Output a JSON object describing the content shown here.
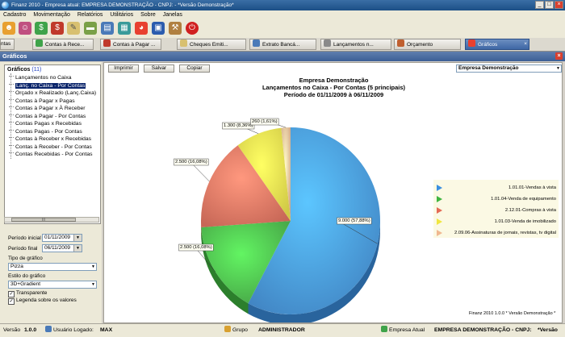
{
  "window": {
    "title": "Finanz 2010 - Empresa atual: EMPRESA DEMONSTRAÇÃO - CNPJ: - *Versão Demonstração*",
    "minimize": "_",
    "maximize": "□",
    "close": "×"
  },
  "menu": [
    "Cadastro",
    "Movimentação",
    "Relatórios",
    "Utilitários",
    "Sobre",
    "Janelas"
  ],
  "tabs": [
    {
      "label": "ntas",
      "icon_color": "#6aa0d8"
    },
    {
      "label": "Contas à Rece...",
      "icon_color": "#3fa34a"
    },
    {
      "label": "Contas à Pagar ...",
      "icon_color": "#c0392b"
    },
    {
      "label": "Cheques Emiti...",
      "icon_color": "#d8c070"
    },
    {
      "label": "Extrato Bancá...",
      "icon_color": "#4a7ab8"
    },
    {
      "label": "Lançamentos n...",
      "icon_color": "#8a8a8a"
    },
    {
      "label": "Orçamento",
      "icon_color": "#c06030"
    },
    {
      "label": "Gráficos",
      "icon_color": "#e84030",
      "active": true
    }
  ],
  "tab_close": "×",
  "panel": {
    "title": "Gráficos",
    "close": "×"
  },
  "tree": {
    "root_label": "Gráficos",
    "root_count": "(11)",
    "items": [
      "Lançamentos no Caixa",
      "Lanç. no Caixa - Por Contas",
      "Orçado x Realizado (Lanç.Caixa)",
      "Contas à Pagar x Pagas",
      "Contas à Pagar x À Receber",
      "Contas à Pagar - Por Contas",
      "Contas Pagas x Recebidas",
      "Contas Pagas - Por Contas",
      "Contas à Receber x Recebidas",
      "Contas à Receber - Por Contas",
      "Contas Recebidas - Por Contas"
    ],
    "selected_index": 1
  },
  "scroll_grip": "III",
  "filters": {
    "periodo_inicial_label": "Período inicial",
    "periodo_inicial": "01/11/2009",
    "periodo_final_label": "Período final",
    "periodo_final": "06/11/2009",
    "tipo_label": "Tipo de gráfico",
    "tipo": "Pizza",
    "estilo_label": "Estilo do gráfico",
    "estilo": "3D+Gradient",
    "transparente_label": "Transparente",
    "legenda_label": "Legenda sobre os valores",
    "check_mark": "✓",
    "dropdown_glyph": "▼"
  },
  "toolbar_buttons": {
    "imprimir": "Imprimir",
    "salvar": "Salvar",
    "copiar": "Copiar"
  },
  "empresa_select": "Empresa Demonstração",
  "chart_data": {
    "type": "pie",
    "title": "Empresa Demonstração",
    "subtitle": "Lançamentos no Caixa - Por Contas (5 principais)",
    "period": "Período de 01/11/2009 à 06/11/2009",
    "categories": [
      "1.01.01-Vendas à vista",
      "1.01.04-Venda de equipamento",
      "2.12.01-Compras à vista",
      "1.01.03-Venda de imobilizado",
      "2.09.06-Assinaturas de jornais, revistas, tv digital"
    ],
    "values": [
      9000,
      2500,
      2500,
      1300,
      260
    ],
    "data_labels": [
      "9.000 (57,88%)",
      "2.500 (16,08%)",
      "2.500 (16,08%)",
      "1.300 (8,36%)",
      "260 (1,61%)"
    ],
    "colors": [
      "#3a8fe0",
      "#3fb53f",
      "#e46a55",
      "#f0e640",
      "#f0b890"
    ],
    "legend_position": "right",
    "footer": "Finanz 2010  1.0.0   * Versão Demonstração *"
  },
  "status": {
    "versao_label": "Versão",
    "versao": "1.0.0",
    "usuario_label": "Usuário Logado:",
    "usuario": "MAX",
    "grupo_label": "Grupo",
    "grupo": "ADMINISTRADOR",
    "empresa_label": "Empresa Atual",
    "empresa": "EMPRESA DEMONSTRAÇÃO - CNPJ:",
    "versao_demo": "*Versão"
  }
}
